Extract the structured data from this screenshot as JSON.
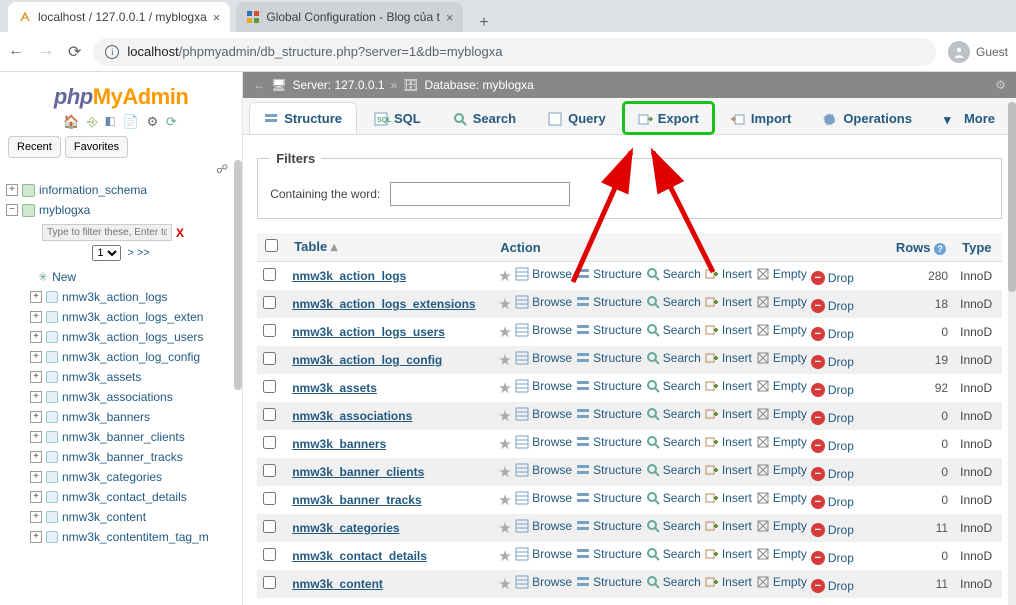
{
  "chrome": {
    "tabs": [
      {
        "title": "localhost / 127.0.0.1 / myblogxa",
        "favicon": "pma"
      },
      {
        "title": "Global Configuration - Blog của t",
        "favicon": "joom"
      }
    ],
    "url_prefix": "localhost",
    "url_rest": "/phpmyadmin/db_structure.php?server=1&db=myblogxa",
    "guest_label": "Guest"
  },
  "sidebar": {
    "logo_php": "php",
    "logo_my": "My",
    "logo_admin": "Admin",
    "recent_label": "Recent",
    "favorites_label": "Favorites",
    "filter_placeholder": "Type to filter these, Enter to s",
    "page_select": "1",
    "page_more": "> >>",
    "new_label": "New",
    "dbs": [
      {
        "name": "information_schema",
        "expanded": false
      },
      {
        "name": "myblogxa",
        "expanded": true
      }
    ],
    "tables": [
      "nmw3k_action_logs",
      "nmw3k_action_logs_exten",
      "nmw3k_action_logs_users",
      "nmw3k_action_log_config",
      "nmw3k_assets",
      "nmw3k_associations",
      "nmw3k_banners",
      "nmw3k_banner_clients",
      "nmw3k_banner_tracks",
      "nmw3k_categories",
      "nmw3k_contact_details",
      "nmw3k_content",
      "nmw3k_contentitem_tag_m"
    ]
  },
  "breadcrumb": {
    "server_label": "Server:",
    "server_value": "127.0.0.1",
    "db_label": "Database:",
    "db_value": "myblogxa"
  },
  "tabs": [
    {
      "label": "Structure",
      "active": true
    },
    {
      "label": "SQL"
    },
    {
      "label": "Search"
    },
    {
      "label": "Query"
    },
    {
      "label": "Export",
      "highlight": true
    },
    {
      "label": "Import"
    },
    {
      "label": "Operations"
    },
    {
      "label": "More",
      "caret": true
    }
  ],
  "filters": {
    "legend": "Filters",
    "word_label": "Containing the word:"
  },
  "table_header": {
    "table": "Table",
    "action": "Action",
    "rows": "Rows",
    "type": "Type"
  },
  "action_labels": {
    "browse": "Browse",
    "structure": "Structure",
    "search": "Search",
    "insert": "Insert",
    "empty": "Empty",
    "drop": "Drop"
  },
  "tables": [
    {
      "name": "nmw3k_action_logs",
      "rows": 280,
      "type": "InnoD"
    },
    {
      "name": "nmw3k_action_logs_extensions",
      "rows": 18,
      "type": "InnoD"
    },
    {
      "name": "nmw3k_action_logs_users",
      "rows": 0,
      "type": "InnoD"
    },
    {
      "name": "nmw3k_action_log_config",
      "rows": 19,
      "type": "InnoD"
    },
    {
      "name": "nmw3k_assets",
      "rows": 92,
      "type": "InnoD"
    },
    {
      "name": "nmw3k_associations",
      "rows": 0,
      "type": "InnoD"
    },
    {
      "name": "nmw3k_banners",
      "rows": 0,
      "type": "InnoD"
    },
    {
      "name": "nmw3k_banner_clients",
      "rows": 0,
      "type": "InnoD"
    },
    {
      "name": "nmw3k_banner_tracks",
      "rows": 0,
      "type": "InnoD"
    },
    {
      "name": "nmw3k_categories",
      "rows": 11,
      "type": "InnoD"
    },
    {
      "name": "nmw3k_contact_details",
      "rows": 0,
      "type": "InnoD"
    },
    {
      "name": "nmw3k_content",
      "rows": 11,
      "type": "InnoD"
    }
  ]
}
